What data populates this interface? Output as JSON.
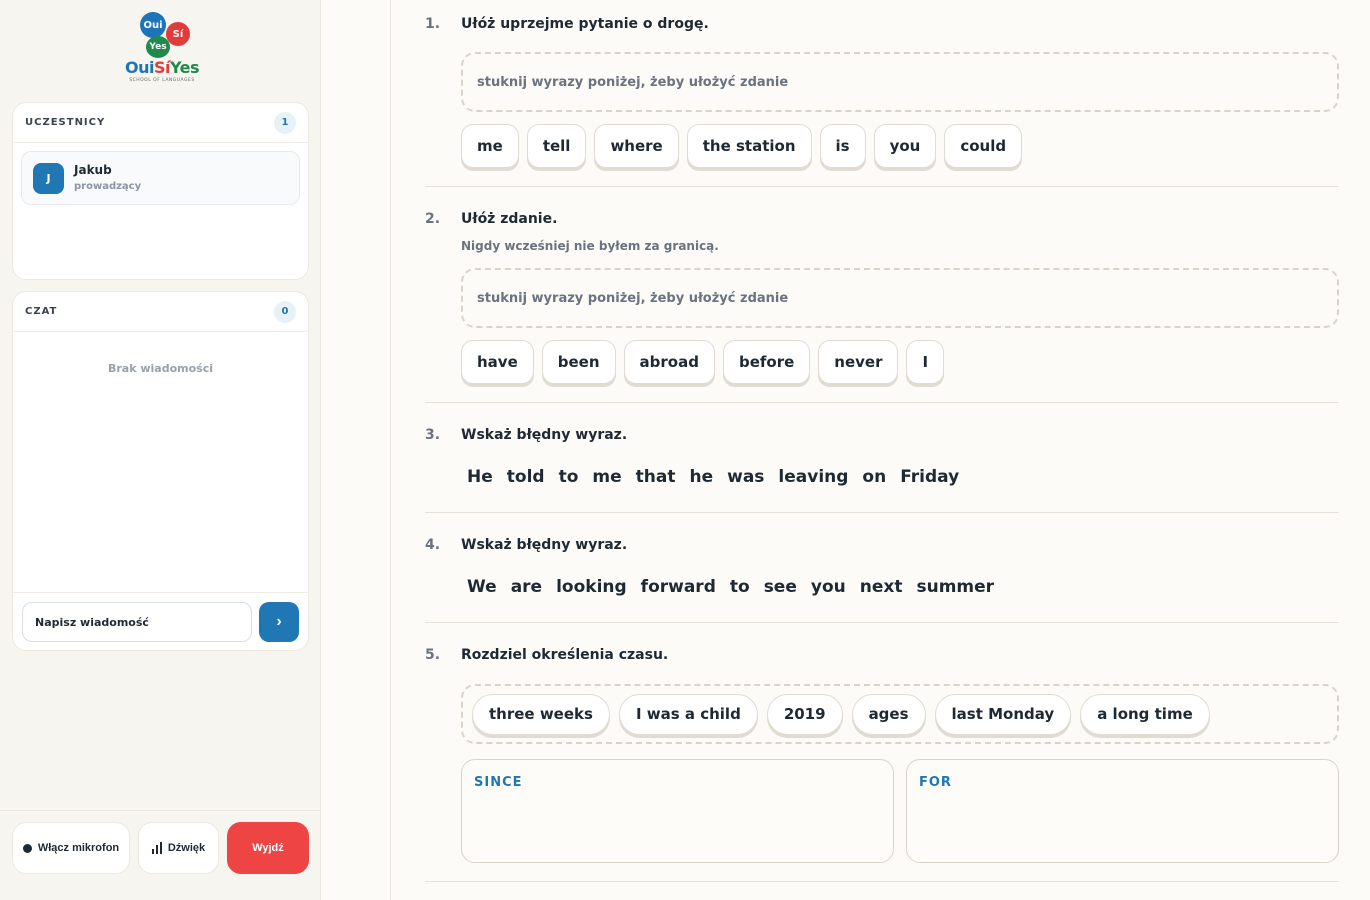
{
  "brand": {
    "bubble_oui": "Oui",
    "bubble_si": "Sí",
    "bubble_yes": "Yes",
    "word_oui": "Oui",
    "word_si": "Sí",
    "word_yes": "Yes",
    "tagline": "SCHOOL OF LANGUAGES"
  },
  "participants": {
    "title": "UCZESTNICY",
    "count": "1",
    "items": [
      {
        "initial": "J",
        "name": "Jakub",
        "role": "prowadzący"
      }
    ]
  },
  "chat": {
    "title": "CZAT",
    "count": "0",
    "empty_text": "Brak wiadomości",
    "input_placeholder": "Napisz wiadomość",
    "send_label": "›"
  },
  "footer": {
    "mic_label": "Włącz mikrofon",
    "sound_label": "Dźwięk",
    "exit_label": "Wyjdź"
  },
  "exercises": [
    {
      "number": "1.",
      "title": "Ułóż uprzejme pytanie o drogę.",
      "dropzone_placeholder": "stuknij wyrazy poniżej, żeby ułożyć zdanie",
      "chips": [
        "me",
        "tell",
        "where",
        "the station",
        "is",
        "you",
        "could"
      ]
    },
    {
      "number": "2.",
      "title": "Ułóż zdanie.",
      "subtitle": "Nigdy wcześniej nie byłem za granicą.",
      "dropzone_placeholder": "stuknij wyrazy poniżej, żeby ułożyć zdanie",
      "chips": [
        "have",
        "been",
        "abroad",
        "before",
        "never",
        "I"
      ]
    },
    {
      "number": "3.",
      "title": "Wskaż błędny wyraz.",
      "words": [
        "He",
        "told",
        "to",
        "me",
        "that",
        "he",
        "was",
        "leaving",
        "on",
        "Friday"
      ]
    },
    {
      "number": "4.",
      "title": "Wskaż błędny wyraz.",
      "words": [
        "We",
        "are",
        "looking",
        "forward",
        "to",
        "see",
        "you",
        "next",
        "summer"
      ]
    },
    {
      "number": "5.",
      "title": "Rozdziel określenia czasu.",
      "pills": [
        "three weeks",
        "I was a child",
        "2019",
        "ages",
        "last Monday",
        "a long time"
      ],
      "buckets": [
        "SINCE",
        "FOR"
      ]
    }
  ]
}
